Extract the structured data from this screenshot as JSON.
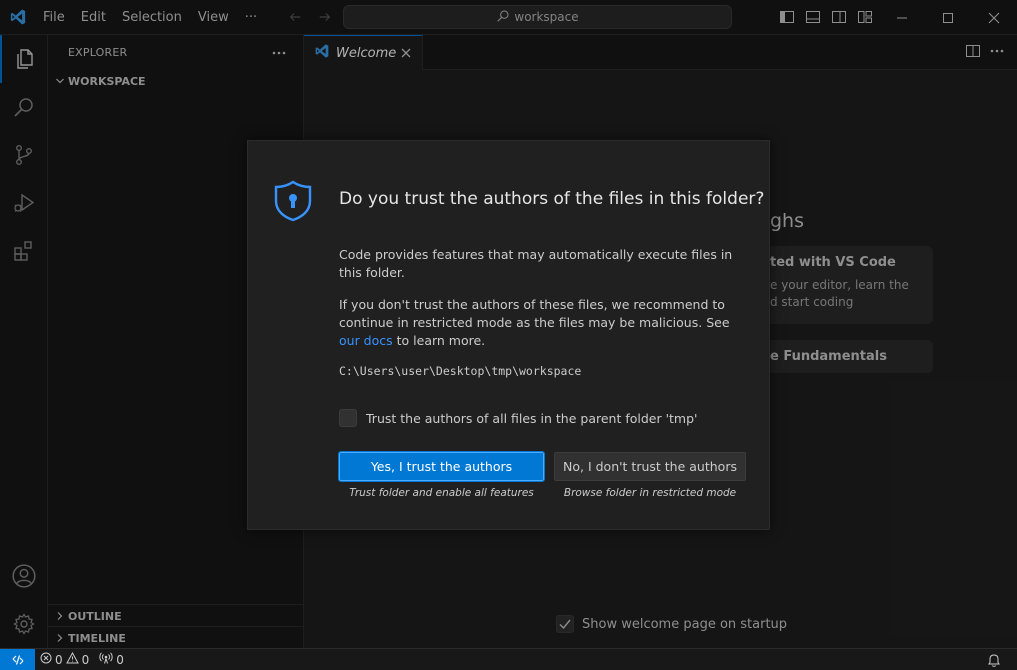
{
  "menu": [
    "File",
    "Edit",
    "Selection",
    "View",
    "···"
  ],
  "search": {
    "text": "workspace"
  },
  "sidebar": {
    "title": "EXPLORER",
    "workspace": "WORKSPACE",
    "outline": "OUTLINE",
    "timeline": "TIMELINE"
  },
  "tab": {
    "label": "Welcome"
  },
  "welcome": {
    "heading_fragment": "ghs",
    "card1_title": "ted with VS Code",
    "card1_line1": "e your editor, learn the",
    "card1_line2": "d start coding",
    "card2_title": "e Fundamentals",
    "startup_label": "Show welcome page on startup"
  },
  "dialog": {
    "title": "Do you trust the authors of the files in this folder?",
    "para1": "Code provides features that may automatically execute files in this folder.",
    "para2_before": "If you don't trust the authors of these files, we recommend to continue in restricted mode as the files may be malicious. See ",
    "para2_link": "our docs",
    "para2_after": " to learn more.",
    "path": "C:\\Users\\user\\Desktop\\tmp\\workspace",
    "checkbox_label": "Trust the authors of all files in the parent folder 'tmp'",
    "yes_button": "Yes, I trust the authors",
    "yes_desc": "Trust folder and enable all features",
    "no_button": "No, I don't trust the authors",
    "no_desc": "Browse folder in restricted mode"
  },
  "status": {
    "errors": "0",
    "warnings": "0",
    "ports": "0"
  },
  "colors": {
    "accent": "#0078d4",
    "link": "#3794ff",
    "shield": "#3794ff"
  }
}
